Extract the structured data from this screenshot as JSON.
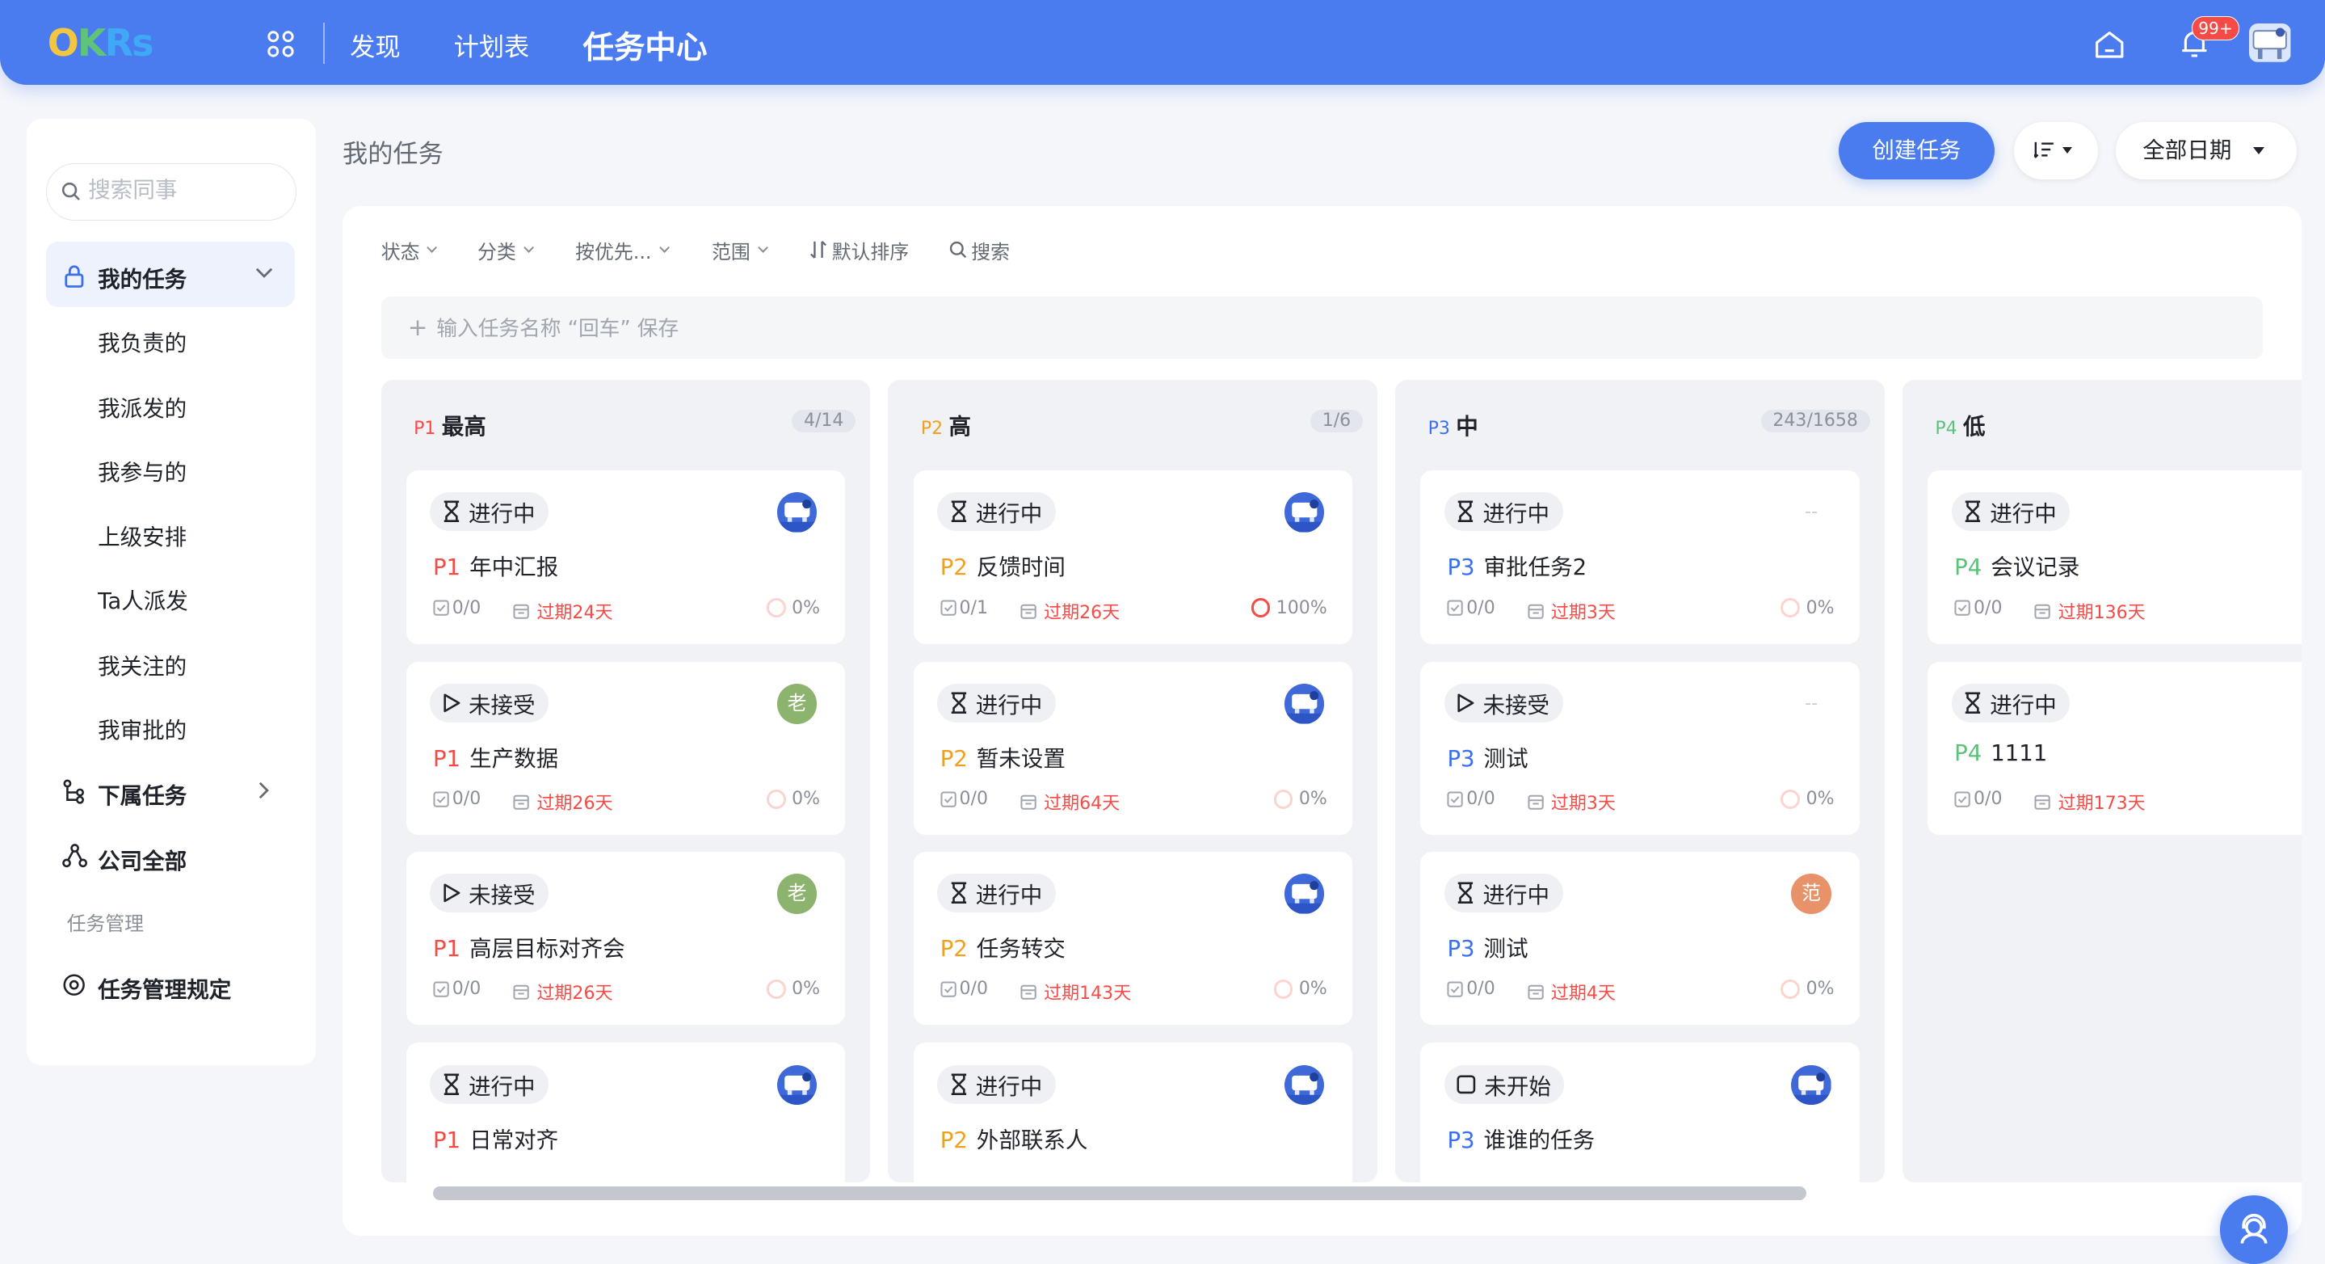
{
  "app": {
    "logo": "OKRs"
  },
  "topnav": {
    "discover": "发现",
    "planner": "计划表",
    "task_center": "任务中心",
    "notification_badge": "99+"
  },
  "sidebar": {
    "search_placeholder": "搜索同事",
    "my_tasks": "我的任务",
    "sub_items": [
      "我负责的",
      "我派发的",
      "我参与的",
      "上级安排",
      "Ta人派发",
      "我关注的",
      "我审批的"
    ],
    "subordinate_tasks": "下属任务",
    "company_all": "公司全部",
    "section_title": "任务管理",
    "rules": "任务管理规定"
  },
  "header": {
    "title": "我的任务",
    "create_button": "创建任务",
    "date_filter": "全部日期"
  },
  "toolbar": {
    "status": "状态",
    "category": "分类",
    "priority": "按优先...",
    "scope": "范围",
    "sort": "默认排序",
    "search": "搜索"
  },
  "quick_add": {
    "placeholder": "输入任务名称 “回车” 保存"
  },
  "colors": {
    "primary": "#4a7cf0",
    "overdue": "#f54a45",
    "p1": "#f54a45",
    "p2": "#f0a020",
    "p3": "#3b6ff0",
    "p4": "#5cc27a"
  },
  "columns": [
    {
      "priority": "P1",
      "name": "最高",
      "count": "4/14",
      "cards": [
        {
          "status": "进行中",
          "status_icon": "hourglass-icon",
          "title": "年中汇报",
          "subtasks": "0/0",
          "due": "过期24天",
          "progress": "0%",
          "avatar": "photo"
        },
        {
          "status": "未接受",
          "status_icon": "play-icon",
          "title": "生产数据",
          "subtasks": "0/0",
          "due": "过期26天",
          "progress": "0%",
          "avatar": "老"
        },
        {
          "status": "未接受",
          "status_icon": "play-icon",
          "title": "高层目标对齐会",
          "subtasks": "0/0",
          "due": "过期26天",
          "progress": "0%",
          "avatar": "老"
        },
        {
          "status": "进行中",
          "status_icon": "hourglass-icon",
          "title": "日常对齐",
          "avatar": "photo"
        }
      ]
    },
    {
      "priority": "P2",
      "name": "高",
      "count": "1/6",
      "cards": [
        {
          "status": "进行中",
          "status_icon": "hourglass-icon",
          "title": "反馈时间",
          "subtasks": "0/1",
          "due": "过期26天",
          "progress": "100%",
          "avatar": "photo"
        },
        {
          "status": "进行中",
          "status_icon": "hourglass-icon",
          "title": "暂未设置",
          "subtasks": "0/0",
          "due": "过期64天",
          "progress": "0%",
          "avatar": "photo"
        },
        {
          "status": "进行中",
          "status_icon": "hourglass-icon",
          "title": "任务转交",
          "subtasks": "0/0",
          "due": "过期143天",
          "progress": "0%",
          "avatar": "photo"
        },
        {
          "status": "进行中",
          "status_icon": "hourglass-icon",
          "title": "外部联系人",
          "avatar": "photo"
        }
      ]
    },
    {
      "priority": "P3",
      "name": "中",
      "count": "243/1658",
      "cards": [
        {
          "status": "进行中",
          "status_icon": "hourglass-icon",
          "title": "审批任务2",
          "subtasks": "0/0",
          "due": "过期3天",
          "progress": "0%",
          "avatar": "--"
        },
        {
          "status": "未接受",
          "status_icon": "play-icon",
          "title": "测试",
          "subtasks": "0/0",
          "due": "过期3天",
          "progress": "0%",
          "avatar": "--"
        },
        {
          "status": "进行中",
          "status_icon": "hourglass-icon",
          "title": "测试",
          "subtasks": "0/0",
          "due": "过期4天",
          "progress": "0%",
          "avatar": "范"
        },
        {
          "status": "未开始",
          "status_icon": "square-icon",
          "title": "谁谁的任务",
          "avatar": "photo"
        }
      ]
    },
    {
      "priority": "P4",
      "name": "低",
      "cards": [
        {
          "status": "进行中",
          "status_icon": "hourglass-icon",
          "title": "会议记录",
          "subtasks": "0/0",
          "due": "过期136天"
        },
        {
          "status": "进行中",
          "status_icon": "hourglass-icon",
          "title": "1111",
          "subtasks": "0/0",
          "due": "过期173天"
        }
      ]
    }
  ]
}
